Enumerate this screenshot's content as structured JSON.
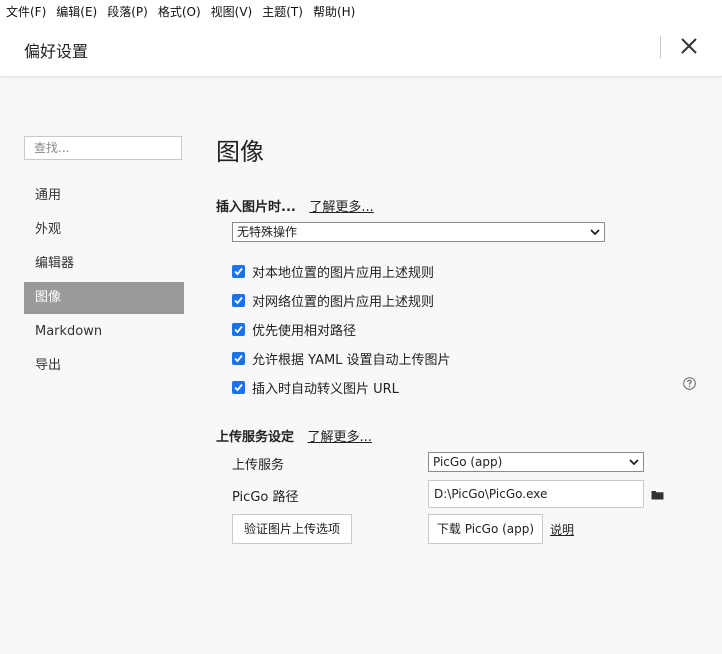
{
  "menubar": {
    "items": [
      "文件(F)",
      "编辑(E)",
      "段落(P)",
      "格式(O)",
      "视图(V)",
      "主题(T)",
      "帮助(H)"
    ]
  },
  "dialog": {
    "title": "偏好设置",
    "close_icon": "close-icon"
  },
  "sidebar": {
    "search_placeholder": "查找...",
    "items": [
      {
        "label": "通用",
        "active": false
      },
      {
        "label": "外观",
        "active": false
      },
      {
        "label": "编辑器",
        "active": false
      },
      {
        "label": "图像",
        "active": true
      },
      {
        "label": "Markdown",
        "active": false
      },
      {
        "label": "导出",
        "active": false
      }
    ]
  },
  "image_page": {
    "title": "图像",
    "insert_section": {
      "heading": "插入图片时...",
      "learn_more": "了解更多...",
      "action_select": "无特殊操作",
      "checkboxes": [
        {
          "label": "对本地位置的图片应用上述规则",
          "checked": true
        },
        {
          "label": "对网络位置的图片应用上述规则",
          "checked": true
        },
        {
          "label": "优先使用相对路径",
          "checked": true
        },
        {
          "label": "允许根据 YAML 设置自动上传图片",
          "checked": true
        },
        {
          "label": "插入时自动转义图片 URL",
          "checked": true
        }
      ],
      "help_icon": "question-circle-icon"
    },
    "upload_section": {
      "heading": "上传服务设定",
      "learn_more": "了解更多...",
      "service_label": "上传服务",
      "service_value": "PicGo (app)",
      "path_label": "PicGo 路径",
      "path_value": "D:\\PicGo\\PicGo.exe",
      "folder_icon": "folder-icon",
      "verify_button": "验证图片上传选项",
      "download_button": "下载 PicGo (app)",
      "explain_link": "说明"
    }
  },
  "colors": {
    "accent": "#1a73e8",
    "active_nav_bg": "#9a9a9a",
    "background": "#f8f8f8"
  }
}
